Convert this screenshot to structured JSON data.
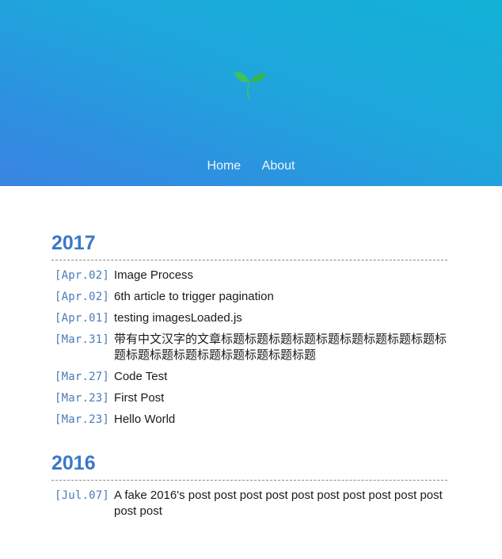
{
  "header": {
    "logo_icon": "sprout-icon",
    "nav": [
      {
        "label": "Home"
      },
      {
        "label": "About"
      }
    ]
  },
  "archive": [
    {
      "year": "2017",
      "posts": [
        {
          "date": "[Apr.02]",
          "title": "Image Process"
        },
        {
          "date": "[Apr.02]",
          "title": "6th article to trigger pagination"
        },
        {
          "date": "[Apr.01]",
          "title": "testing imagesLoaded.js"
        },
        {
          "date": "[Mar.31]",
          "title": "带有中文汉字的文章标题标题标题标题标题标题标题标题标题标题标题标题标题标题标题标题标题标题"
        },
        {
          "date": "[Mar.27]",
          "title": "Code Test"
        },
        {
          "date": "[Mar.23]",
          "title": "First Post"
        },
        {
          "date": "[Mar.23]",
          "title": "Hello World"
        }
      ]
    },
    {
      "year": "2016",
      "posts": [
        {
          "date": "[Jul.07]",
          "title": "A fake 2016's post post post post post post post post post post post post"
        }
      ]
    }
  ],
  "colors": {
    "header_gradient_start": "#12b2d6",
    "header_gradient_end": "#3a84e0",
    "year": "#3a78c8",
    "date": "#4a7ab8",
    "leaf": "#3cc35a"
  }
}
